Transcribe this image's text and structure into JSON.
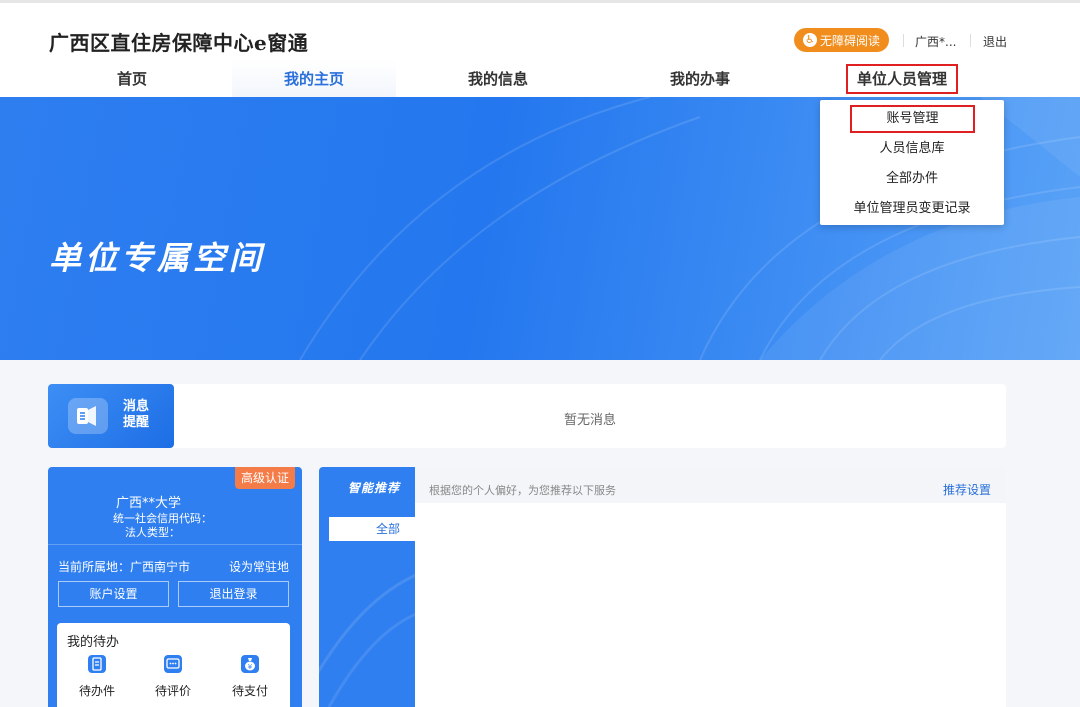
{
  "header": {
    "site_title": "广西区直住房保障中心e窗通",
    "a11y_label": "无障碍阅读",
    "user": "广西*...",
    "logout": "退出"
  },
  "nav": {
    "items": [
      {
        "label": "首页"
      },
      {
        "label": "我的主页"
      },
      {
        "label": "我的信息"
      },
      {
        "label": "我的办事"
      },
      {
        "label": "单位人员管理"
      }
    ],
    "active_index": 1
  },
  "dropdown": {
    "items": [
      {
        "label": "账号管理"
      },
      {
        "label": "人员信息库"
      },
      {
        "label": "全部办件"
      },
      {
        "label": "单位管理员变更记录"
      }
    ]
  },
  "banner": {
    "title": "单位专属空间"
  },
  "message": {
    "badge_line1": "消息",
    "badge_line2": "提醒",
    "empty_text": "暂无消息"
  },
  "profile": {
    "level_badge": "高级认证",
    "name": "广西**大学",
    "credit_code_label": "统一社会信用代码：",
    "legal_type_label": "法人类型：",
    "location": "当前所属地：广西南宁市",
    "set_default": "设为常驻地",
    "account_settings": "账户设置",
    "sign_out": "退出登录",
    "todo_title": "我的待办",
    "todo_items": [
      {
        "label": "待办件",
        "icon": "clipboard-icon"
      },
      {
        "label": "待评价",
        "icon": "chat-icon"
      },
      {
        "label": "待支付",
        "icon": "money-bag-icon"
      }
    ]
  },
  "recommend": {
    "title": "智能推荐",
    "tab_all": "全部",
    "hint": "根据您的个人偏好，为您推荐以下服务",
    "settings": "推荐设置"
  },
  "colors": {
    "primary": "#2f7ff0",
    "accent_orange": "#f08d1c",
    "badge_orange": "#f47c48",
    "highlight_red": "#e02020"
  }
}
